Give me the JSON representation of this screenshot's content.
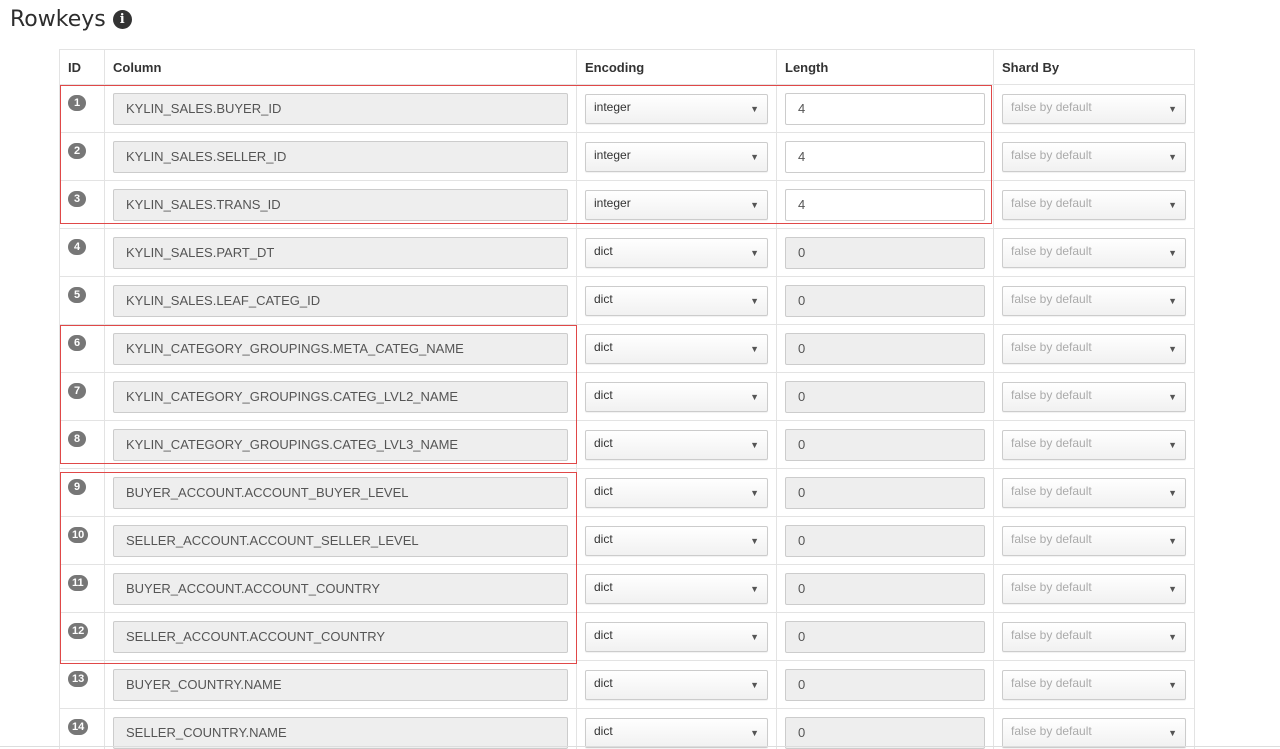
{
  "header": {
    "title": "Rowkeys",
    "info_icon": "info-circle-icon"
  },
  "table": {
    "columns": {
      "id": "ID",
      "column": "Column",
      "encoding": "Encoding",
      "length": "Length",
      "shard_by": "Shard By"
    },
    "rows": [
      {
        "id": "1",
        "column": "KYLIN_SALES.BUYER_ID",
        "encoding": "integer",
        "length": "4",
        "shard_by": "false by default",
        "length_editable": true
      },
      {
        "id": "2",
        "column": "KYLIN_SALES.SELLER_ID",
        "encoding": "integer",
        "length": "4",
        "shard_by": "false by default",
        "length_editable": true
      },
      {
        "id": "3",
        "column": "KYLIN_SALES.TRANS_ID",
        "encoding": "integer",
        "length": "4",
        "shard_by": "false by default",
        "length_editable": true
      },
      {
        "id": "4",
        "column": "KYLIN_SALES.PART_DT",
        "encoding": "dict",
        "length": "0",
        "shard_by": "false by default",
        "length_editable": false
      },
      {
        "id": "5",
        "column": "KYLIN_SALES.LEAF_CATEG_ID",
        "encoding": "dict",
        "length": "0",
        "shard_by": "false by default",
        "length_editable": false
      },
      {
        "id": "6",
        "column": "KYLIN_CATEGORY_GROUPINGS.META_CATEG_NAME",
        "encoding": "dict",
        "length": "0",
        "shard_by": "false by default",
        "length_editable": false
      },
      {
        "id": "7",
        "column": "KYLIN_CATEGORY_GROUPINGS.CATEG_LVL2_NAME",
        "encoding": "dict",
        "length": "0",
        "shard_by": "false by default",
        "length_editable": false
      },
      {
        "id": "8",
        "column": "KYLIN_CATEGORY_GROUPINGS.CATEG_LVL3_NAME",
        "encoding": "dict",
        "length": "0",
        "shard_by": "false by default",
        "length_editable": false
      },
      {
        "id": "9",
        "column": "BUYER_ACCOUNT.ACCOUNT_BUYER_LEVEL",
        "encoding": "dict",
        "length": "0",
        "shard_by": "false by default",
        "length_editable": false
      },
      {
        "id": "10",
        "column": "SELLER_ACCOUNT.ACCOUNT_SELLER_LEVEL",
        "encoding": "dict",
        "length": "0",
        "shard_by": "false by default",
        "length_editable": false
      },
      {
        "id": "11",
        "column": "BUYER_ACCOUNT.ACCOUNT_COUNTRY",
        "encoding": "dict",
        "length": "0",
        "shard_by": "false by default",
        "length_editable": false
      },
      {
        "id": "12",
        "column": "SELLER_ACCOUNT.ACCOUNT_COUNTRY",
        "encoding": "dict",
        "length": "0",
        "shard_by": "false by default",
        "length_editable": false
      },
      {
        "id": "13",
        "column": "BUYER_COUNTRY.NAME",
        "encoding": "dict",
        "length": "0",
        "shard_by": "false by default",
        "length_editable": false
      },
      {
        "id": "14",
        "column": "SELLER_COUNTRY.NAME",
        "encoding": "dict",
        "length": "0",
        "shard_by": "false by default",
        "length_editable": false
      }
    ]
  },
  "colors": {
    "highlight_border": "#e04848",
    "badge": "#777777",
    "readonly_field": "#eeeeee"
  }
}
